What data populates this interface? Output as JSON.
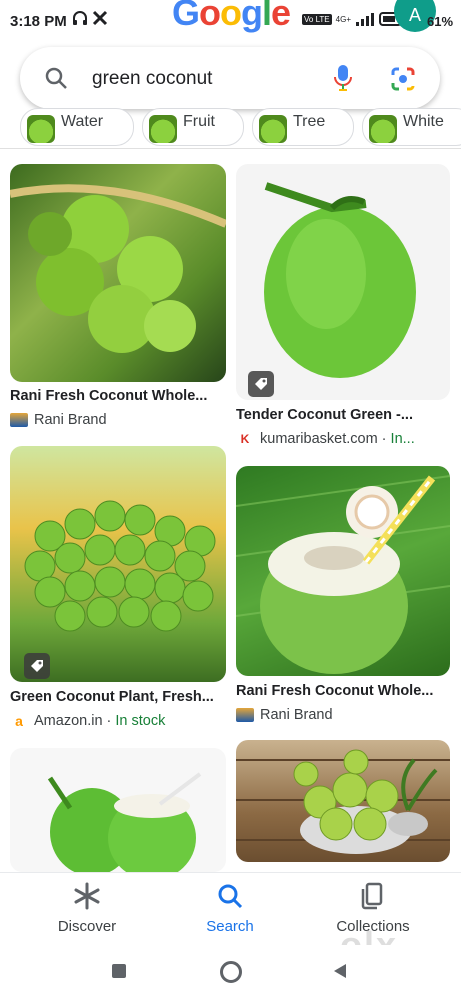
{
  "status_bar": {
    "time": "3:18 PM",
    "network_label": "Vo LTE",
    "signal_label": "4G+",
    "battery_percent": "61%"
  },
  "header": {
    "logo": [
      "G",
      "o",
      "o",
      "g",
      "l",
      "e"
    ],
    "logo_colors": [
      "#4285F4",
      "#EA4335",
      "#FBBC05",
      "#4285F4",
      "#34A853",
      "#EA4335"
    ],
    "avatar_letter": "A",
    "avatar_color": "#0f9d8a"
  },
  "search": {
    "query": "green coconut",
    "icons": [
      "search-icon",
      "mic-icon",
      "lens-icon"
    ]
  },
  "chips": [
    {
      "label": "Water"
    },
    {
      "label": "Fruit"
    },
    {
      "label": "Tree"
    },
    {
      "label": "White"
    }
  ],
  "results": [
    {
      "title": "Rani Fresh Coconut Whole...",
      "source": "Rani Brand",
      "stock": ""
    },
    {
      "title": "Tender Coconut Green -...",
      "source": "kumaribasket.com",
      "sep": " · ",
      "stock": "In..."
    },
    {
      "title": "Green Coconut Plant, Fresh...",
      "source": "Amazon.in",
      "sep": " · ",
      "stock": "In stock"
    },
    {
      "title": "Rani Fresh Coconut Whole...",
      "source": "Rani Brand",
      "stock": ""
    },
    {
      "title": "",
      "source": "",
      "stock": ""
    },
    {
      "title": "",
      "source": "",
      "stock": ""
    }
  ],
  "bottom_nav": {
    "items": [
      {
        "label": "Discover",
        "icon": "asterisk-icon",
        "active": false
      },
      {
        "label": "Search",
        "icon": "search-icon",
        "active": true
      },
      {
        "label": "Collections",
        "icon": "collections-icon",
        "active": false
      }
    ],
    "active_color": "#1a73e8"
  },
  "watermark": {
    "text": "olx"
  }
}
